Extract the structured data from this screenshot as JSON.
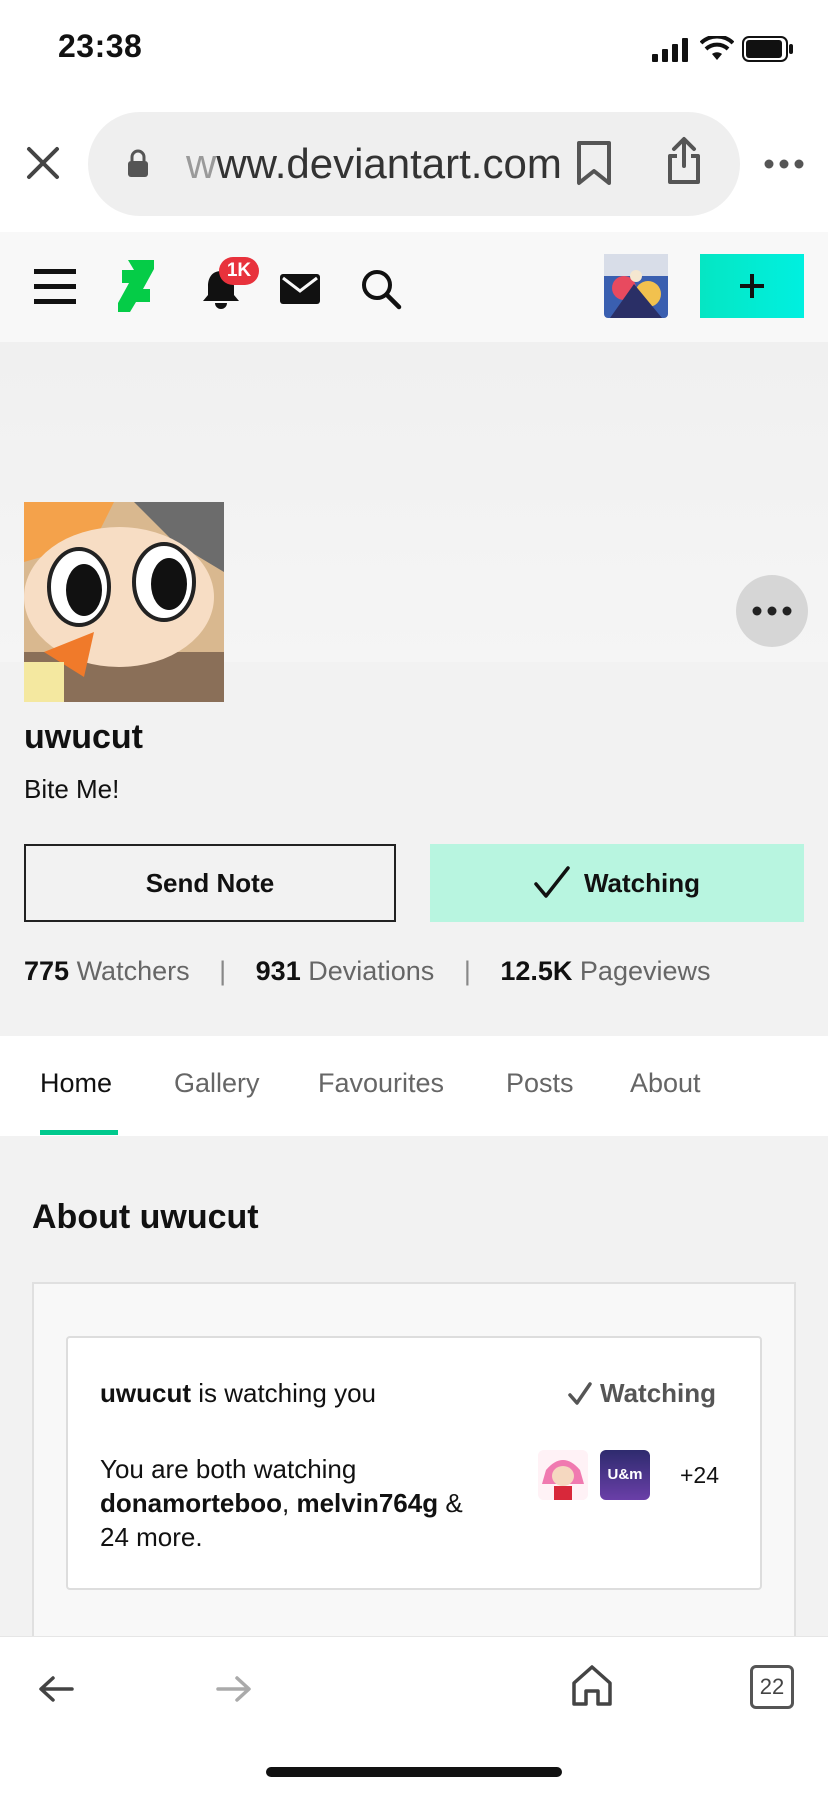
{
  "status_bar": {
    "time": "23:38"
  },
  "browser": {
    "url_faded": "w",
    "url_main": "ww.deviantart.com"
  },
  "header": {
    "notifications_badge": "1K",
    "create_label": "+"
  },
  "profile": {
    "username": "uwucut",
    "tagline": "Bite Me!",
    "send_note_label": "Send Note",
    "watching_label": "Watching",
    "stats": {
      "watchers_count": "775",
      "watchers_label": "Watchers",
      "deviations_count": "931",
      "deviations_label": "Deviations",
      "pageviews_count": "12.5K",
      "pageviews_label": "Pageviews",
      "separator": "|"
    }
  },
  "tabs": [
    "Home",
    "Gallery",
    "Favourites",
    "Posts",
    "About"
  ],
  "about": {
    "title": "About uwucut",
    "watcher_name": "uwucut",
    "watching_you_text": " is watching you",
    "watching_status": "Watching",
    "mutual_prefix": "You are both watching",
    "mutual_user1": "donamorteboo",
    "mutual_user2": "melvin764g",
    "mutual_suffix": "24 more.",
    "mutual_avatar2_text": "U&m",
    "mutual_more_count": "+24"
  },
  "toolbar": {
    "tab_count": "22"
  },
  "colors": {
    "brand_green": "#05cc47",
    "accent_teal": "#00c98d",
    "watching_bg": "#b8f5e0",
    "badge_red": "#e8323c"
  }
}
